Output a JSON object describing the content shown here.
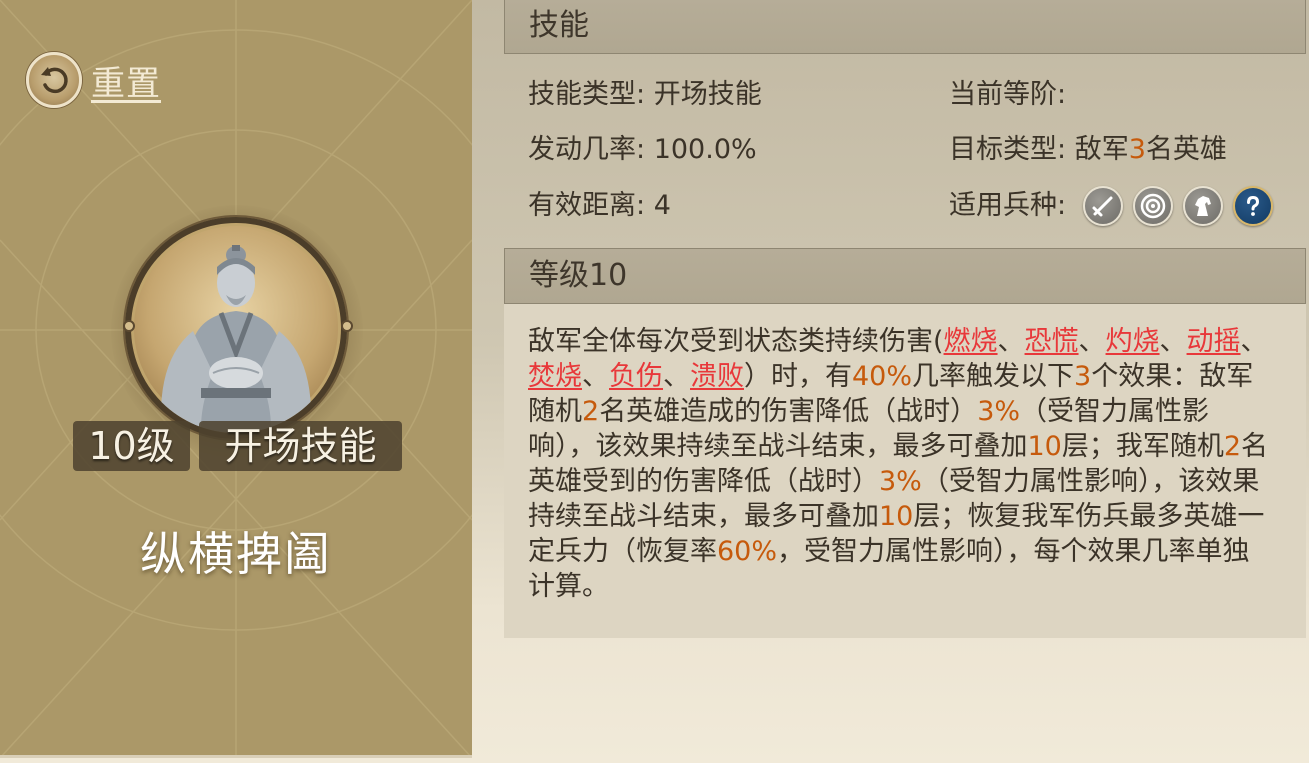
{
  "left_panel": {
    "reset_label": "重置",
    "level_badge": "10级",
    "skill_type_badge": "开场技能",
    "skill_name": "纵横捭阖"
  },
  "skill_section": {
    "header": "技能",
    "skill_type": {
      "label": "技能类型:",
      "value": "开场技能"
    },
    "current_tier": {
      "label": "当前等阶:",
      "value": ""
    },
    "trigger_rate": {
      "label": "发动几率:",
      "value": "100.0%"
    },
    "target_type": {
      "label": "目标类型:",
      "prefix": "敌军",
      "count": "3",
      "suffix": "名英雄"
    },
    "range": {
      "label": "有效距离:",
      "value": "4"
    },
    "unit_types": {
      "label": "适用兵种:",
      "icons": [
        "sword-icon",
        "target-icon",
        "horse-icon",
        "question-icon"
      ]
    }
  },
  "level_section": {
    "header": "等级10",
    "description_segments": [
      {
        "text": "敌军全体每次受到状态类持续伤害(",
        "style": "normal"
      },
      {
        "text": "燃烧",
        "style": "red"
      },
      {
        "text": "、",
        "style": "normal"
      },
      {
        "text": "恐慌",
        "style": "red"
      },
      {
        "text": "、",
        "style": "normal"
      },
      {
        "text": "灼烧",
        "style": "red"
      },
      {
        "text": "、",
        "style": "normal"
      },
      {
        "text": "动摇",
        "style": "red"
      },
      {
        "text": "、",
        "style": "normal"
      },
      {
        "text": "焚烧",
        "style": "red"
      },
      {
        "text": "、",
        "style": "normal"
      },
      {
        "text": "负伤",
        "style": "red"
      },
      {
        "text": "、",
        "style": "normal"
      },
      {
        "text": "溃败",
        "style": "red"
      },
      {
        "text": "）时，有",
        "style": "normal"
      },
      {
        "text": "40%",
        "style": "org"
      },
      {
        "text": "几率触发以下",
        "style": "normal"
      },
      {
        "text": "3",
        "style": "org"
      },
      {
        "text": "个效果：敌军随机",
        "style": "normal"
      },
      {
        "text": "2",
        "style": "org"
      },
      {
        "text": "名英雄造成的伤害降低（战时）",
        "style": "normal"
      },
      {
        "text": "3%",
        "style": "org"
      },
      {
        "text": "（受智力属性影响），该效果持续至战斗结束，最多可叠加",
        "style": "normal"
      },
      {
        "text": "10",
        "style": "org"
      },
      {
        "text": "层；我军随机",
        "style": "normal"
      },
      {
        "text": "2",
        "style": "org"
      },
      {
        "text": "名英雄受到的伤害降低（战时）",
        "style": "normal"
      },
      {
        "text": "3%",
        "style": "org"
      },
      {
        "text": "（受智力属性影响），该效果持续至战斗结束，最多可叠加",
        "style": "normal"
      },
      {
        "text": "10",
        "style": "org"
      },
      {
        "text": "层；恢复我军伤兵最多英雄一定兵力（恢复率",
        "style": "normal"
      },
      {
        "text": "60%",
        "style": "org"
      },
      {
        "text": "，受智力属性影响），每个效果几率单独计算。",
        "style": "normal"
      }
    ]
  },
  "colors": {
    "highlight_orange": "#c65a0c",
    "status_red": "#e8383a",
    "left_panel_bg": "#ab9868"
  }
}
